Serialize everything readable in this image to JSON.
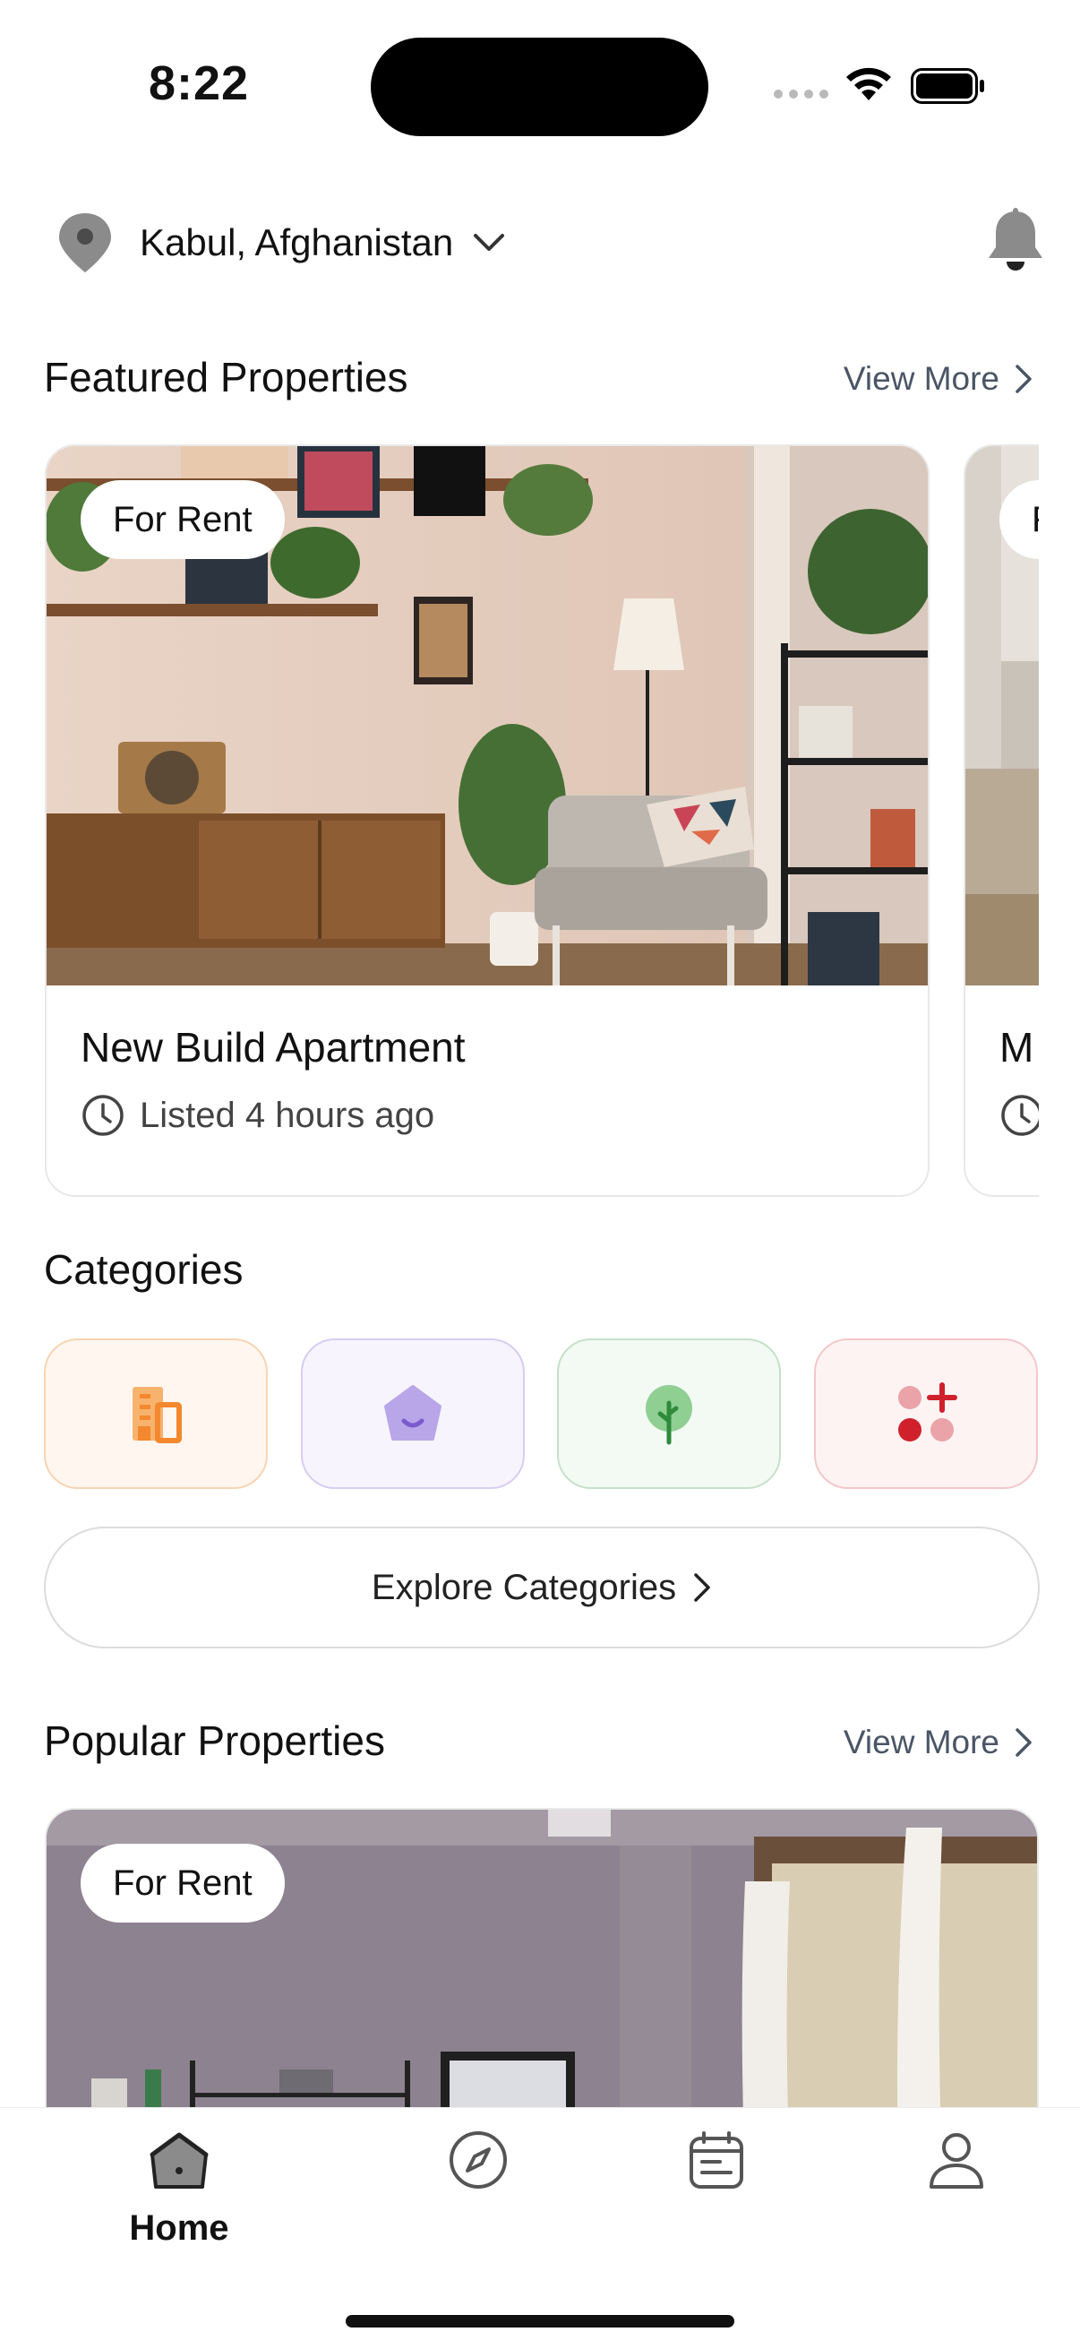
{
  "status_bar": {
    "time": "8:22"
  },
  "header": {
    "location": "Kabul, Afghanistan"
  },
  "featured": {
    "title": "Featured Properties",
    "view_more": "View More",
    "cards": [
      {
        "badge": "For Rent",
        "title": "New Build Apartment",
        "listed": "Listed 4 hours ago"
      },
      {
        "badge": "F",
        "title": "M",
        "listed": ""
      }
    ]
  },
  "categories": {
    "title": "Categories",
    "items": [
      {
        "icon": "building-icon",
        "color": "#f4882e",
        "bg": "#fff7ef",
        "border": "#f8d4b2"
      },
      {
        "icon": "home-icon",
        "color": "#9a7fd6",
        "bg": "#f7f4fe",
        "border": "#d7cdf2"
      },
      {
        "icon": "tree-icon",
        "color": "#3f9b4e",
        "bg": "#f3f9f3",
        "border": "#c6e1c8"
      },
      {
        "icon": "more-icon",
        "color": "#d0202c",
        "bg": "#fef3f3",
        "border": "#f3c7ca"
      }
    ],
    "explore": "Explore Categories"
  },
  "popular": {
    "title": "Popular Properties",
    "view_more": "View More",
    "cards": [
      {
        "badge": "For Rent"
      }
    ]
  },
  "tabbar": {
    "tabs": [
      {
        "label": "Home",
        "icon": "home-tab-icon",
        "active": true
      },
      {
        "label": "",
        "icon": "compass-icon",
        "active": false
      },
      {
        "label": "",
        "icon": "calendar-icon",
        "active": false
      },
      {
        "label": "",
        "icon": "profile-icon",
        "active": false
      }
    ]
  }
}
